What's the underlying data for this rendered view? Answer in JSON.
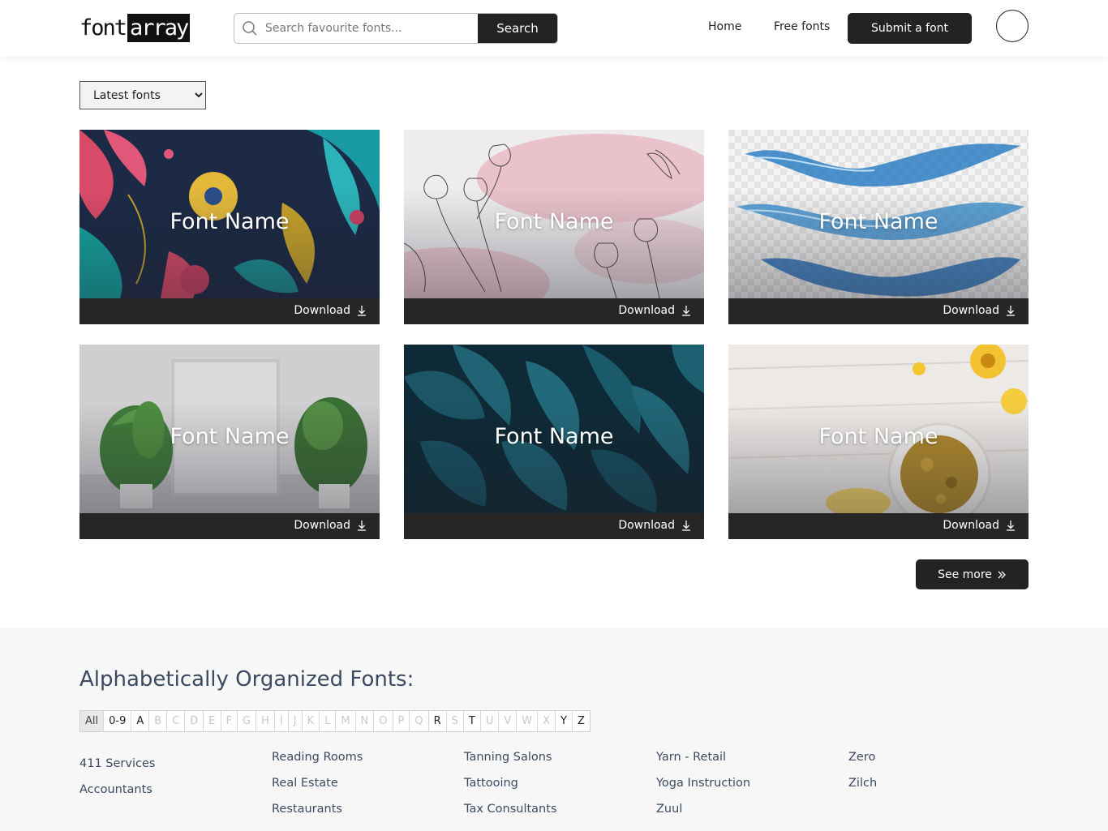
{
  "header": {
    "logo_part1": "font",
    "logo_part2": "array",
    "search_placeholder": "Search favourite fonts...",
    "search_button": "Search",
    "nav_home": "Home",
    "nav_free_fonts": "Free fonts",
    "submit_button": "Submit a font"
  },
  "sort": {
    "selected": "Latest fonts"
  },
  "cards": [
    {
      "name": "Font Name",
      "download": "Download",
      "theme": "floral-dark"
    },
    {
      "name": "Font Name",
      "download": "Download",
      "theme": "watercolor-flowers"
    },
    {
      "name": "Font Name",
      "download": "Download",
      "theme": "water-splash"
    },
    {
      "name": "Font Name",
      "download": "Download",
      "theme": "plants-frame"
    },
    {
      "name": "Font Name",
      "download": "Download",
      "theme": "tropical-leaves"
    },
    {
      "name": "Font Name",
      "download": "Download",
      "theme": "spice-bowl"
    }
  ],
  "see_more": "See more",
  "alphabet": {
    "title": "Alphabetically Organized Fonts:",
    "letters": [
      {
        "label": "All",
        "active": true
      },
      {
        "label": "0-9",
        "active": true
      },
      {
        "label": "A",
        "active": true
      },
      {
        "label": "B",
        "active": false
      },
      {
        "label": "C",
        "active": false
      },
      {
        "label": "D",
        "active": false
      },
      {
        "label": "E",
        "active": false
      },
      {
        "label": "F",
        "active": false
      },
      {
        "label": "G",
        "active": false
      },
      {
        "label": "H",
        "active": false
      },
      {
        "label": "I",
        "active": false
      },
      {
        "label": "J",
        "active": false
      },
      {
        "label": "K",
        "active": false
      },
      {
        "label": "L",
        "active": false
      },
      {
        "label": "M",
        "active": false
      },
      {
        "label": "N",
        "active": false
      },
      {
        "label": "O",
        "active": false
      },
      {
        "label": "P",
        "active": false
      },
      {
        "label": "Q",
        "active": false
      },
      {
        "label": "R",
        "active": true
      },
      {
        "label": "S",
        "active": false
      },
      {
        "label": "T",
        "active": true
      },
      {
        "label": "U",
        "active": false
      },
      {
        "label": "V",
        "active": false
      },
      {
        "label": "W",
        "active": false
      },
      {
        "label": "X",
        "active": false
      },
      {
        "label": "Y",
        "active": true
      },
      {
        "label": "Z",
        "active": true
      }
    ],
    "columns": [
      [
        "411 Services",
        "Accountants"
      ],
      [
        "Reading Rooms",
        "Real Estate",
        "Restaurants"
      ],
      [
        "Tanning Salons",
        "Tattooing",
        "Tax Consultants"
      ],
      [
        "Yarn - Retail",
        "Yoga Instruction",
        "Zuul"
      ],
      [
        "Zero",
        "Zilch"
      ]
    ]
  }
}
